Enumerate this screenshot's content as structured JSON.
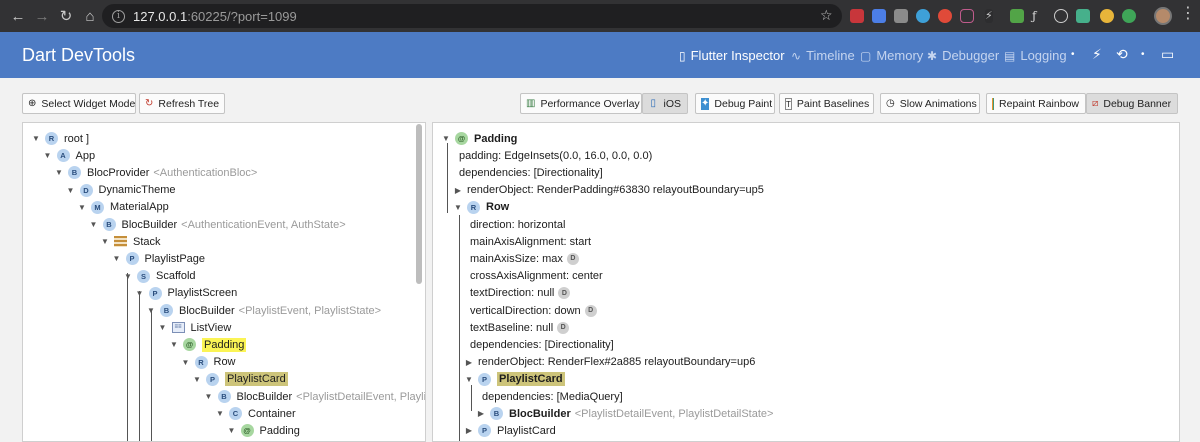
{
  "browser": {
    "url_host": "127.0.0.1",
    "url_rest": ":60225/?port=1099"
  },
  "header": {
    "title": "Dart DevTools",
    "nav": [
      "Flutter Inspector",
      "Timeline",
      "Memory",
      "Debugger",
      "Logging"
    ]
  },
  "toolbar": {
    "left": [
      "Select Widget Mode",
      "Refresh Tree"
    ],
    "right": [
      "Performance Overlay",
      "iOS",
      "Debug Paint",
      "Paint Baselines",
      "Slow Animations",
      "Repaint Rainbow",
      "Debug Banner"
    ]
  },
  "tree": [
    {
      "label": "root ]",
      "badge": "R"
    },
    {
      "label": "App",
      "badge": "A"
    },
    {
      "label": "BlocProvider",
      "badge": "B",
      "extra": "<AuthenticationBloc>"
    },
    {
      "label": "DynamicTheme",
      "badge": "D"
    },
    {
      "label": "MaterialApp",
      "badge": "M"
    },
    {
      "label": "BlocBuilder",
      "badge": "B",
      "extra": "<AuthenticationEvent, AuthState>"
    },
    {
      "label": "Stack",
      "badge": ""
    },
    {
      "label": "PlaylistPage",
      "badge": "P"
    },
    {
      "label": "Scaffold",
      "badge": "S"
    },
    {
      "label": "PlaylistScreen",
      "badge": "P"
    },
    {
      "label": "BlocBuilder",
      "badge": "B",
      "extra": "<PlaylistEvent, PlaylistState>"
    },
    {
      "label": "ListView",
      "badge": ""
    },
    {
      "label": "Padding",
      "badge": "@"
    },
    {
      "label": "Row",
      "badge": "R"
    },
    {
      "label": "PlaylistCard",
      "badge": "P"
    },
    {
      "label": "BlocBuilder",
      "badge": "B",
      "extra": "<PlaylistDetailEvent, PlaylistD"
    },
    {
      "label": "Container",
      "badge": "C"
    },
    {
      "label": "Padding",
      "badge": "@"
    }
  ],
  "details": [
    {
      "label": "Padding",
      "badge": "@"
    },
    {
      "label": "padding: EdgeInsets(0.0, 16.0, 0.0, 0.0)"
    },
    {
      "label": "dependencies: [Directionality]"
    },
    {
      "label": "renderObject: RenderPadding#63830 relayoutBoundary=up5"
    },
    {
      "label": "Row",
      "badge": "R"
    },
    {
      "label": "direction: horizontal"
    },
    {
      "label": "mainAxisAlignment: start"
    },
    {
      "label": "mainAxisSize: max",
      "badge_d": "D"
    },
    {
      "label": "crossAxisAlignment: center"
    },
    {
      "label": "textDirection: null",
      "badge_d": "D"
    },
    {
      "label": "verticalDirection: down",
      "badge_d": "D"
    },
    {
      "label": "textBaseline: null",
      "badge_d": "D"
    },
    {
      "label": "dependencies: [Directionality]"
    },
    {
      "label": "renderObject: RenderFlex#2a885 relayoutBoundary=up6"
    },
    {
      "label": "PlaylistCard",
      "badge": "P"
    },
    {
      "label": "dependencies: [MediaQuery]"
    },
    {
      "label": "BlocBuilder",
      "badge": "B",
      "extra": "<PlaylistDetailEvent, PlaylistDetailState>"
    },
    {
      "label": "PlaylistCard",
      "badge": "P"
    }
  ]
}
